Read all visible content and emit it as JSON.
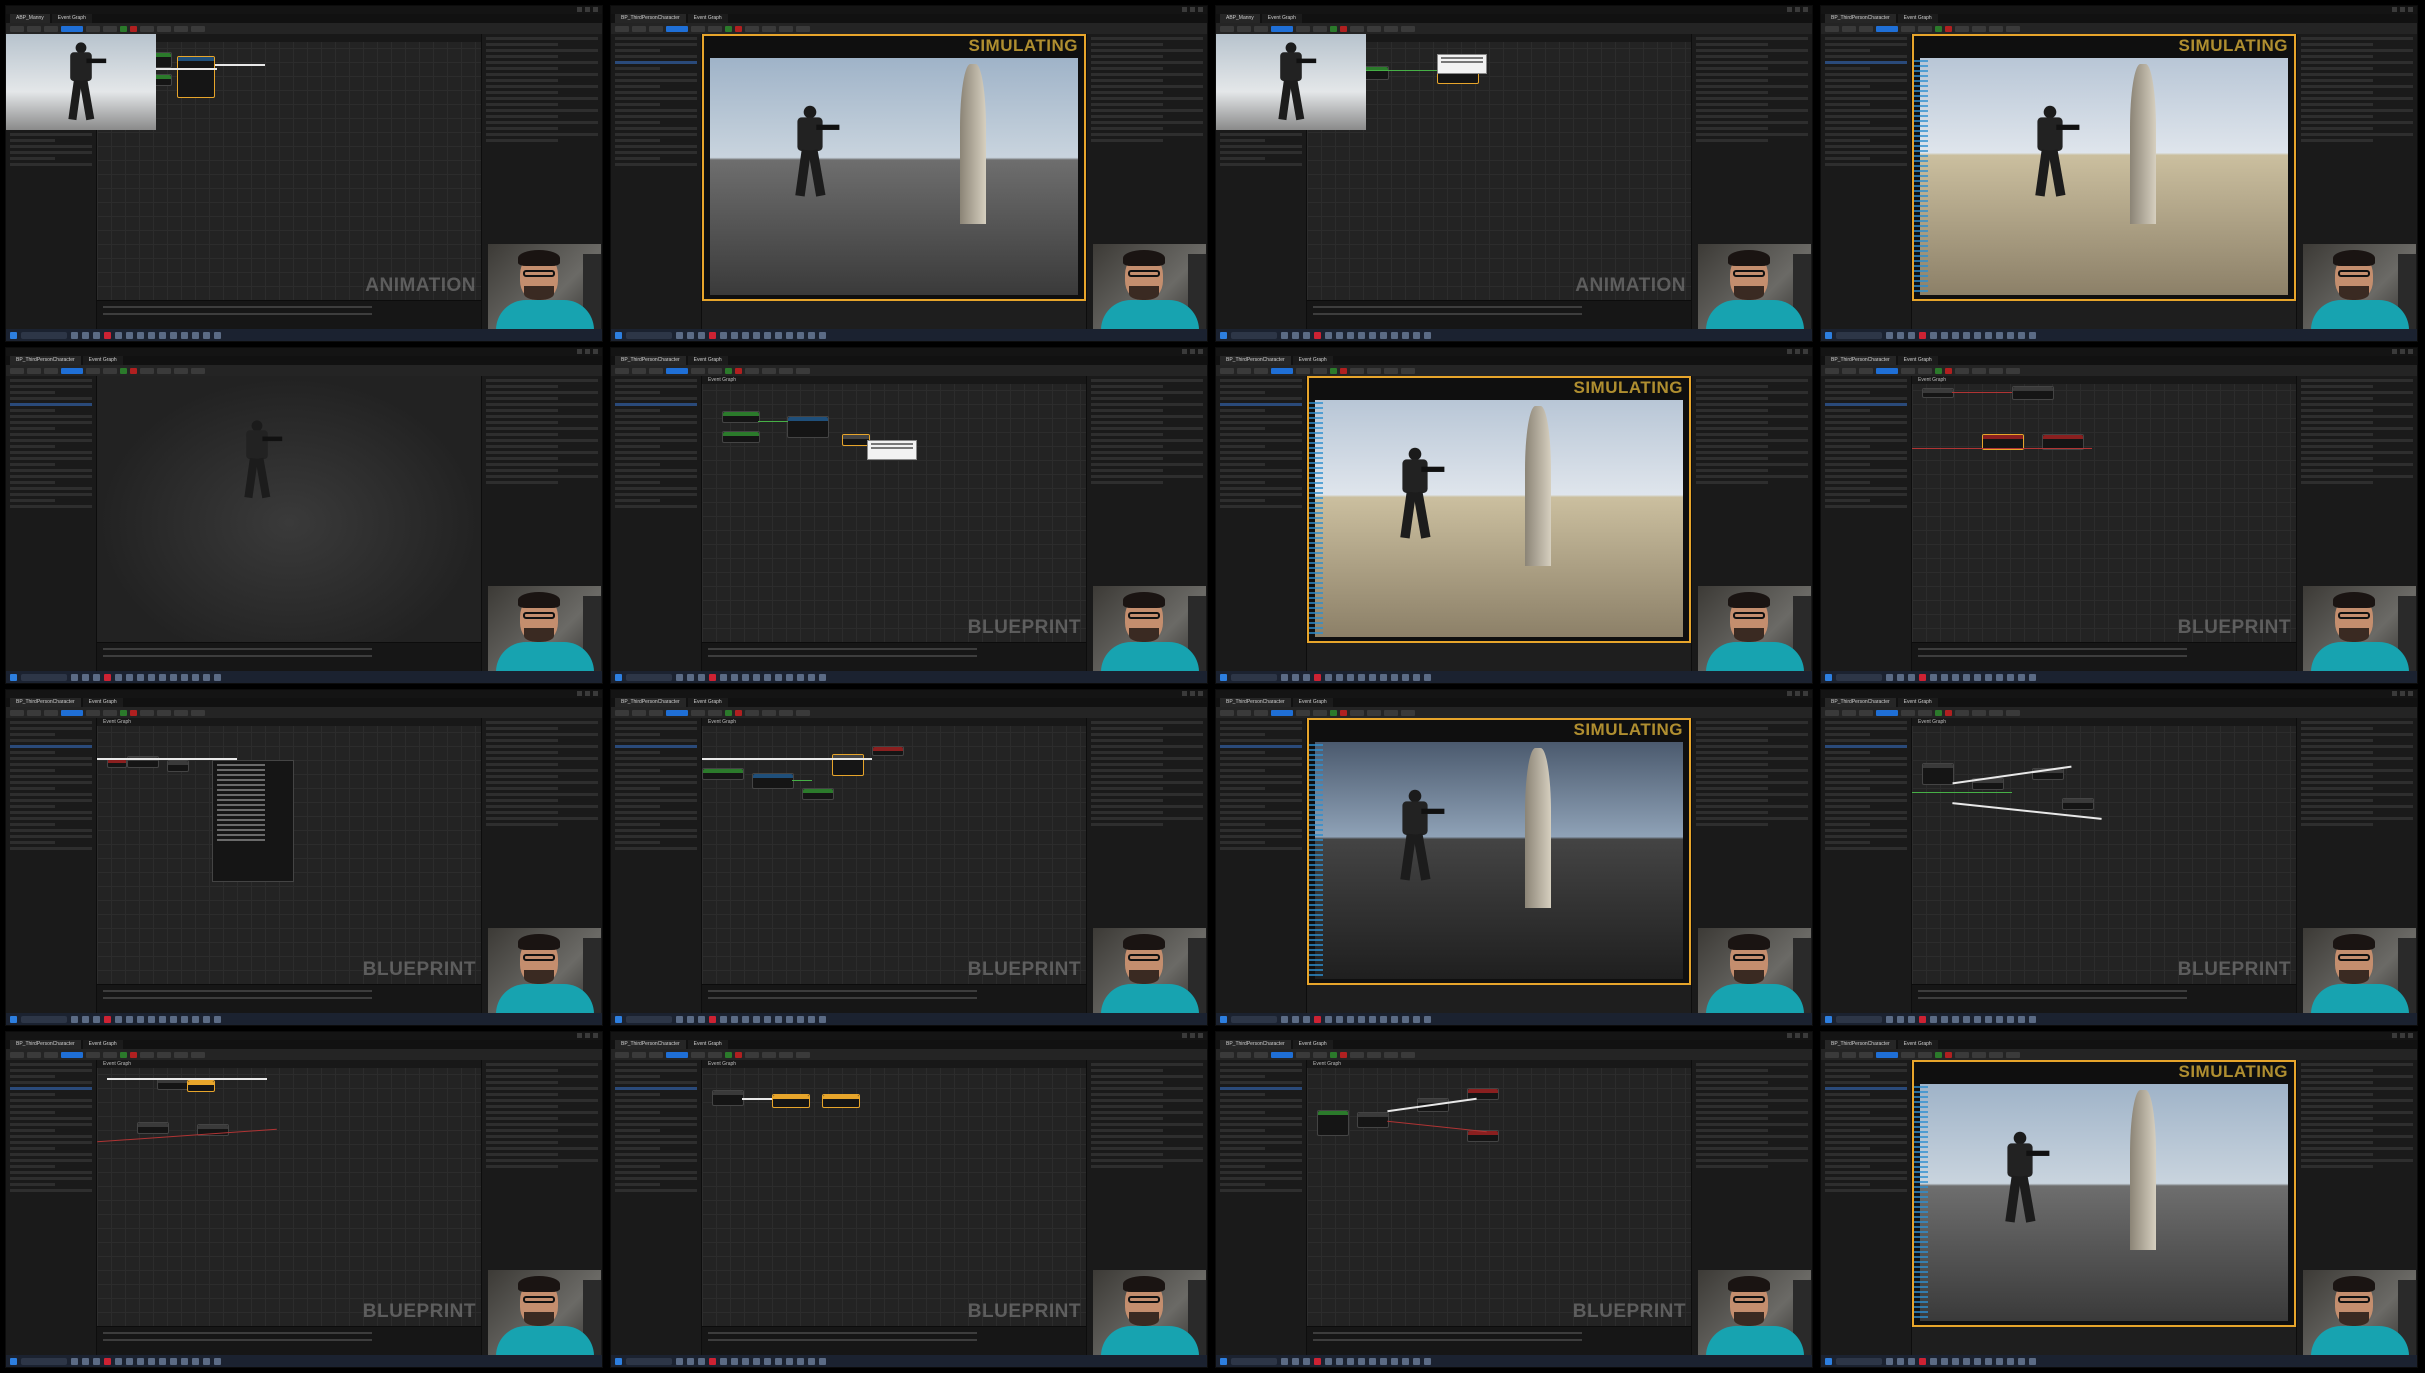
{
  "grid": {
    "tiles": [
      {
        "label": "ANIMATION",
        "tab": "ABP_Manny",
        "mode": "animation"
      },
      {
        "label": "SIMULATING",
        "tab": "BP_ThirdPersonCharacter",
        "mode": "simulating"
      },
      {
        "label": "ANIMATION",
        "tab": "ABP_Manny",
        "mode": "animation"
      },
      {
        "label": "SIMULATING",
        "tab": "BP_ThirdPersonCharacter",
        "mode": "simulating"
      },
      {
        "label": "",
        "tab": "BP_ThirdPersonCharacter",
        "mode": "viewport"
      },
      {
        "label": "BLUEPRINT",
        "tab": "BP_ThirdPersonCharacter",
        "mode": "blueprint"
      },
      {
        "label": "SIMULATING",
        "tab": "BP_ThirdPersonCharacter",
        "mode": "simulating"
      },
      {
        "label": "BLUEPRINT",
        "tab": "BP_ThirdPersonCharacter",
        "mode": "blueprint"
      },
      {
        "label": "BLUEPRINT",
        "tab": "BP_ThirdPersonCharacter",
        "mode": "blueprint-menu"
      },
      {
        "label": "BLUEPRINT",
        "tab": "BP_ThirdPersonCharacter",
        "mode": "blueprint"
      },
      {
        "label": "SIMULATING",
        "tab": "BP_ThirdPersonCharacter",
        "mode": "simulating"
      },
      {
        "label": "BLUEPRINT",
        "tab": "BP_ThirdPersonCharacter",
        "mode": "blueprint"
      },
      {
        "label": "BLUEPRINT",
        "tab": "BP_ThirdPersonCharacter",
        "mode": "blueprint"
      },
      {
        "label": "BLUEPRINT",
        "tab": "BP_ThirdPersonCharacter",
        "mode": "blueprint"
      },
      {
        "label": "BLUEPRINT",
        "tab": "BP_ThirdPersonCharacter",
        "mode": "blueprint"
      },
      {
        "label": "SIMULATING",
        "tab": "BP_ThirdPersonCharacter",
        "mode": "simulating"
      }
    ]
  },
  "labels": {
    "animation": "ANIMATION",
    "blueprint": "BLUEPRINT",
    "simulating": "SIMULATING",
    "event_graph": "Event Graph"
  },
  "colors": {
    "simulating_border": "#e7a52b",
    "wire_exec": "#e8e8e8",
    "wire_red": "#b03434",
    "wire_green": "#46b046",
    "accent_blue": "#1f6fd6"
  },
  "icons": [
    "unreal-logo-icon",
    "play-icon",
    "stop-icon",
    "compile-icon",
    "search-icon",
    "webcam-feed"
  ]
}
